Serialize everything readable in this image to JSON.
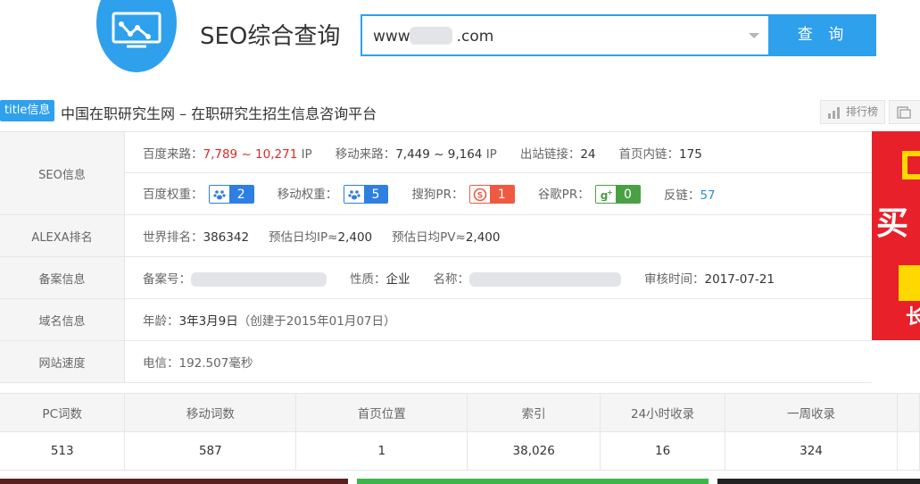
{
  "header": {
    "brand": "SEO综合查询",
    "search": {
      "value_prefix": "www.",
      "value_suffix": ".com"
    },
    "search_button": "查 询"
  },
  "title_row": {
    "tag": "title信息",
    "text": "中国在职研究生网 – 在职研究生招生信息咨询平台",
    "rank_button": "排行榜"
  },
  "seo": {
    "label": "SEO信息",
    "baidu_source_label": "百度来路：",
    "baidu_source_value": "7,789 ~ 10,271",
    "baidu_source_unit": "IP",
    "mobile_source_label": "移动来路：",
    "mobile_source_value": "7,449 ~ 9,164",
    "mobile_source_unit": "IP",
    "outlinks_label": "出站链接：",
    "outlinks_value": "24",
    "inlinks_label": "首页内链：",
    "inlinks_value": "175",
    "baidu_weight_label": "百度权重：",
    "baidu_weight_value": "2",
    "mobile_weight_label": "移动权重：",
    "mobile_weight_value": "5",
    "sogou_pr_label": "搜狗PR：",
    "sogou_pr_value": "1",
    "google_pr_label": "谷歌PR：",
    "google_pr_value": "0",
    "backlinks_label": "反链：",
    "backlinks_value": "57"
  },
  "alexa": {
    "label": "ALEXA排名",
    "world_rank_label": "世界排名：",
    "world_rank_value": "386342",
    "daily_ip_label": "预估日均IP≈",
    "daily_ip_value": "2,400",
    "daily_pv_label": "预估日均PV≈",
    "daily_pv_value": "2,400"
  },
  "icp": {
    "label": "备案信息",
    "number_label": "备案号：",
    "nature_label": "性质：",
    "nature_value": "企业",
    "name_label": "名称：",
    "audit_label": "审核时间：",
    "audit_value": "2017-07-21"
  },
  "domain": {
    "label": "域名信息",
    "age_label": "年龄：",
    "age_value": "3年3月9日",
    "created_note": "（创建于2015年01月07日）"
  },
  "speed": {
    "label": "网站速度",
    "telecom": "电信：192.507毫秒"
  },
  "stats": {
    "headers": [
      "PC词数",
      "移动词数",
      "首页位置",
      "索引",
      "24小时收录",
      "一周收录"
    ],
    "values": [
      "513",
      "587",
      "1",
      "38,026",
      "16",
      "324"
    ]
  },
  "ad": {
    "line1": "买",
    "line2": "长"
  },
  "colors": {
    "accent": "#2ea0ec",
    "red": "#e02828",
    "baidu_blue": "#2e7fe0",
    "sogou_red": "#ee5a41",
    "google_green": "#4aa145"
  }
}
